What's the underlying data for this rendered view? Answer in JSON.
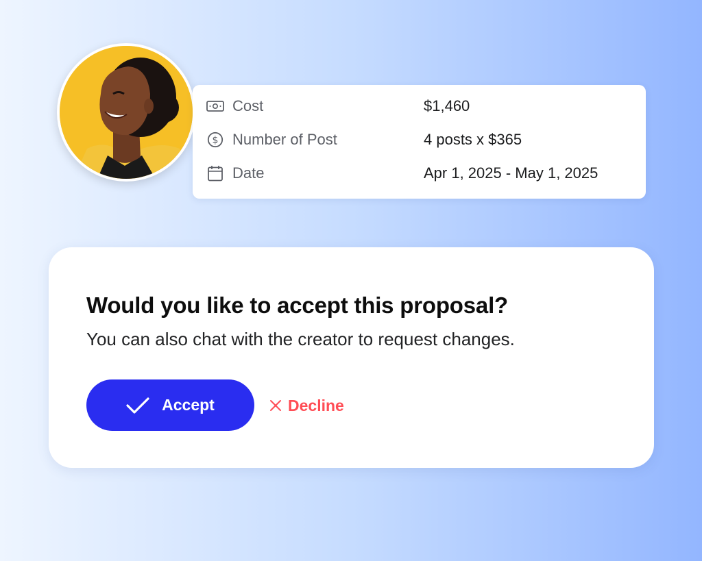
{
  "details": {
    "rows": [
      {
        "icon": "banknote-icon",
        "label": "Cost",
        "value": "$1,460"
      },
      {
        "icon": "dollar-circle-icon",
        "label": "Number of Post",
        "value": "4 posts x $365"
      },
      {
        "icon": "calendar-icon",
        "label": "Date",
        "value": "Apr 1, 2025 - May 1, 2025"
      }
    ]
  },
  "proposal": {
    "title": "Would you like to accept this proposal?",
    "subtitle": "You can also chat with the creator to request changes.",
    "accept_label": "Accept",
    "decline_label": "Decline"
  },
  "colors": {
    "accent": "#2a2df0",
    "decline": "#ff4d55",
    "avatar_bg": "#f6bf26"
  }
}
